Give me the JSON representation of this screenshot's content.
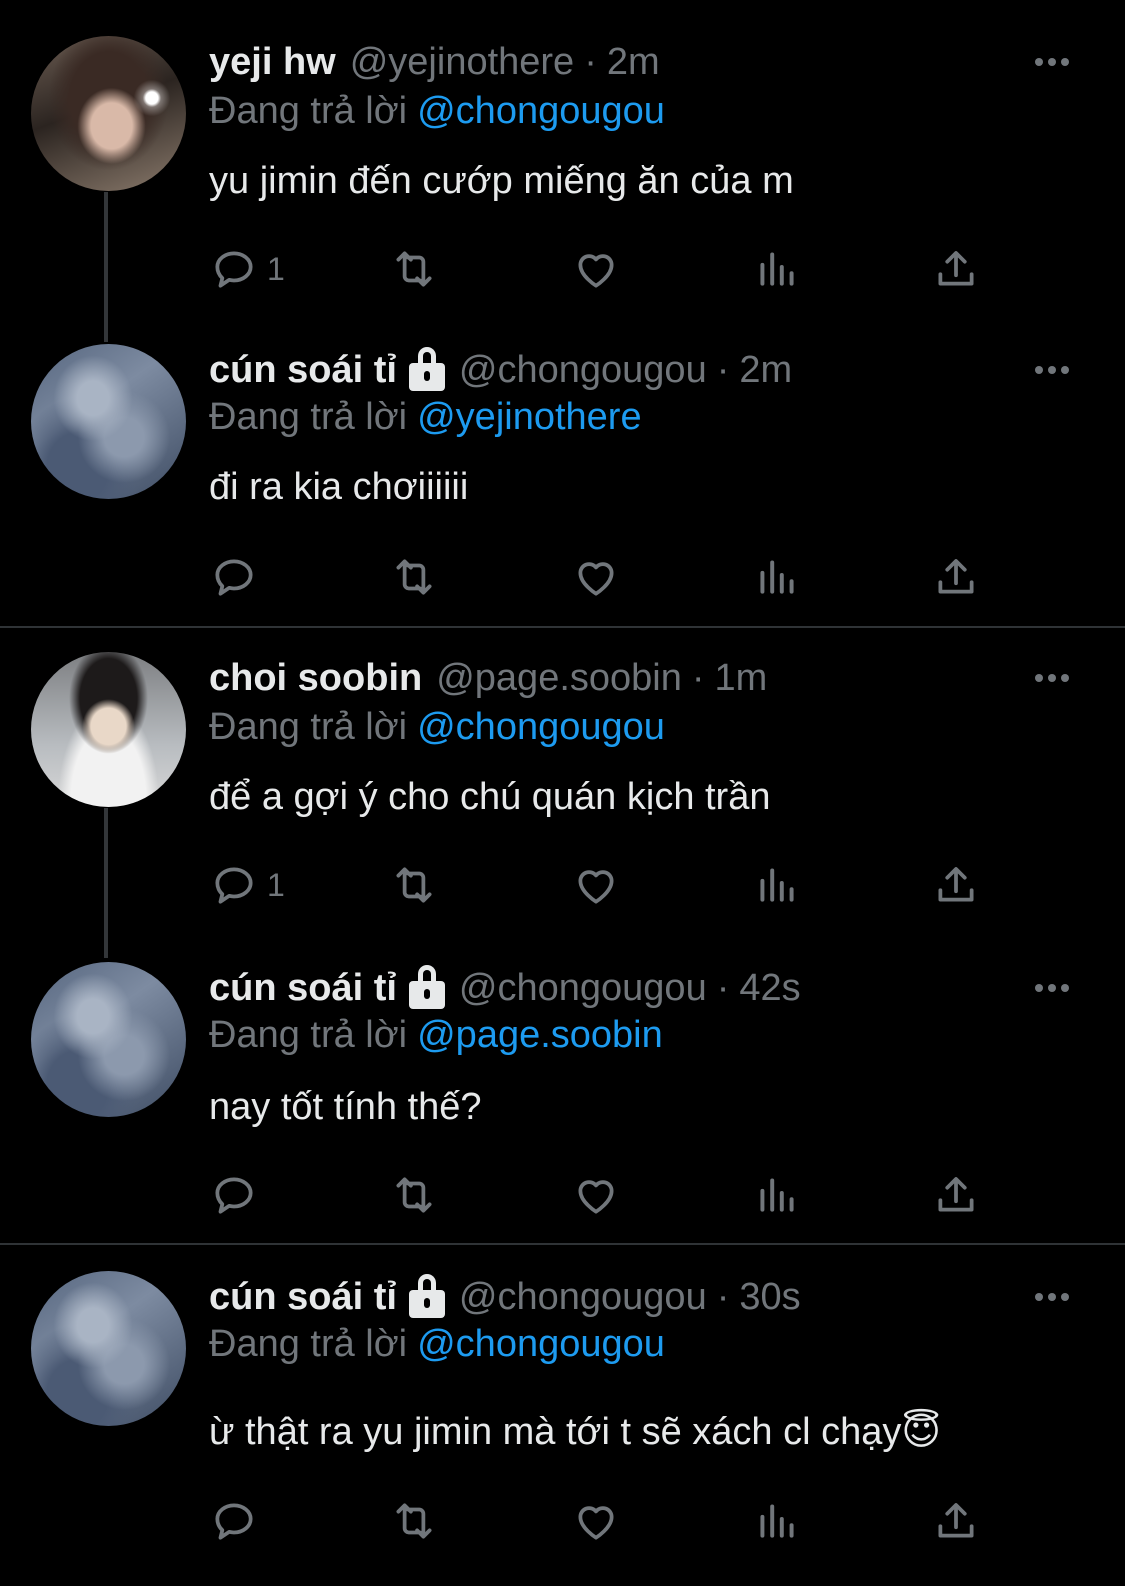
{
  "tweets": [
    {
      "name": "yeji hw",
      "handle": "@yejinothere",
      "separator": "·",
      "time": "2m",
      "reply_label": "Đang trả lời",
      "reply_to": "@chongougou",
      "text": "yu jimin đến cướp miếng ăn của m",
      "reply_count": "1",
      "protected": false
    },
    {
      "name": "cún soái tỉ",
      "handle": "@chongougou",
      "separator": "·",
      "time": "2m",
      "reply_label": "Đang trả lời",
      "reply_to": "@yejinothere",
      "text": "đi ra kia chơiiiiii",
      "reply_count": "",
      "protected": true
    },
    {
      "name": "choi soobin",
      "handle": "@page.soobin",
      "separator": "·",
      "time": "1m",
      "reply_label": "Đang trả lời",
      "reply_to": "@chongougou",
      "text": "để a gợi ý cho chú quán kịch trần",
      "reply_count": "1",
      "protected": false
    },
    {
      "name": "cún soái tỉ",
      "handle": "@chongougou",
      "separator": "·",
      "time": "42s",
      "reply_label": "Đang trả lời",
      "reply_to": "@page.soobin",
      "text": "nay tốt tính thế?",
      "reply_count": "",
      "protected": true
    },
    {
      "name": "cún soái tỉ",
      "handle": "@chongougou",
      "separator": "·",
      "time": "30s",
      "reply_label": "Đang trả lời",
      "reply_to": "@chongougou",
      "text": "ừ thật ra yu jimin mà tới t sẽ xách cl chạy😇",
      "reply_count": "",
      "protected": true
    }
  ],
  "colors": {
    "background": "#000000",
    "primary_text": "#e7e9ea",
    "secondary_text": "#71767b",
    "link": "#1d9bf0",
    "divider": "#2f3336"
  },
  "icons": [
    "reply-icon",
    "retweet-icon",
    "like-icon",
    "views-icon",
    "share-icon",
    "more-icon",
    "lock-icon"
  ]
}
